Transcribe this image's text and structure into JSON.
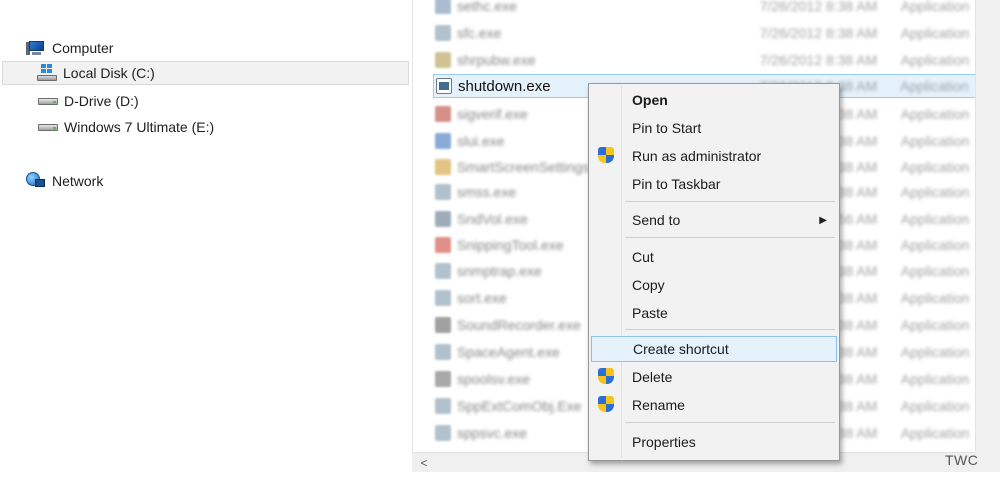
{
  "navigation": {
    "computer": "Computer",
    "drives": [
      {
        "label": "Local Disk (C:)",
        "icon": "os-drive-icon",
        "selected": true
      },
      {
        "label": "D-Drive (D:)",
        "icon": "drive-icon",
        "selected": false
      },
      {
        "label": "Windows 7 Ultimate (E:)",
        "icon": "drive-icon",
        "selected": false
      }
    ],
    "network": "Network"
  },
  "files": [
    {
      "name": "sethc.exe",
      "date": "7/26/2012 8:38 AM",
      "type": "Application",
      "icon_color": "#7d9bb8",
      "blurred": true
    },
    {
      "name": "sfc.exe",
      "date": "7/26/2012 8:38 AM",
      "type": "Application",
      "icon_color": "#8aa0b5",
      "blurred": true
    },
    {
      "name": "shrpubw.exe",
      "date": "7/26/2012 8:38 AM",
      "type": "Application",
      "icon_color": "#b8a25a",
      "blurred": true
    },
    {
      "name": "shutdown.exe",
      "date": "7/26/2012 8:38 AM",
      "type": "Application",
      "icon_color": "#3f6f8c",
      "blurred": false,
      "selected": true
    },
    {
      "name": "sigverif.exe",
      "date": "7/26/2012 8:38 AM",
      "type": "Application",
      "icon_color": "#c0554a",
      "blurred": true
    },
    {
      "name": "slui.exe",
      "date": "7/26/2012 8:38 AM",
      "type": "Application",
      "icon_color": "#4a7fc0",
      "blurred": true
    },
    {
      "name": "SmartScreenSettings.exe",
      "date": "7/26/2012 8:38 AM",
      "type": "Application",
      "icon_color": "#d6a640",
      "blurred": true
    },
    {
      "name": "smss.exe",
      "date": "7/26/2012 8:38 AM",
      "type": "Application",
      "icon_color": "#8aa0b5",
      "blurred": true
    },
    {
      "name": "SndVol.exe",
      "date": "7/26/2012 8:56 AM",
      "type": "Application",
      "icon_color": "#6b7f95",
      "blurred": true
    },
    {
      "name": "SnippingTool.exe",
      "date": "7/26/2012 8:38 AM",
      "type": "Application",
      "icon_color": "#d0554a",
      "blurred": true
    },
    {
      "name": "snmptrap.exe",
      "date": "7/26/2012 8:38 AM",
      "type": "Application",
      "icon_color": "#8aa0b5",
      "blurred": true
    },
    {
      "name": "sort.exe",
      "date": "7/26/2012 8:38 AM",
      "type": "Application",
      "icon_color": "#8aa0b5",
      "blurred": true
    },
    {
      "name": "SoundRecorder.exe",
      "date": "7/26/2012 8:38 AM",
      "type": "Application",
      "icon_color": "#6f6f6f",
      "blurred": true
    },
    {
      "name": "SpaceAgent.exe",
      "date": "7/26/2012 8:38 AM",
      "type": "Application",
      "icon_color": "#8aa0b5",
      "blurred": true
    },
    {
      "name": "spoolsv.exe",
      "date": "7/26/2012 8:38 AM",
      "type": "Application",
      "icon_color": "#7a7a7a",
      "blurred": true
    },
    {
      "name": "SppExtComObj.Exe",
      "date": "7/26/2012 8:38 AM",
      "type": "Application",
      "icon_color": "#8aa0b5",
      "blurred": true
    },
    {
      "name": "sppsvc.exe",
      "date": "7/26/2012 8:38 AM",
      "type": "Application",
      "icon_color": "#8aa0b5",
      "blurred": true
    }
  ],
  "context_menu": {
    "items": [
      {
        "label": "Open",
        "bold": true,
        "shield": false
      },
      {
        "label": "Pin to Start",
        "shield": false
      },
      {
        "label": "Run as administrator",
        "shield": true
      },
      {
        "label": "Pin to Taskbar",
        "shield": false
      },
      {
        "label": "Send to",
        "shield": false,
        "submenu_arrow": "▶"
      },
      {
        "label": "Cut",
        "shield": false
      },
      {
        "label": "Copy",
        "shield": false
      },
      {
        "label": "Paste",
        "shield": false
      },
      {
        "label": "Create shortcut",
        "shield": false,
        "hover": true
      },
      {
        "label": "Delete",
        "shield": true
      },
      {
        "label": "Rename",
        "shield": true
      },
      {
        "label": "Properties",
        "shield": false
      }
    ]
  },
  "scrollbar": {
    "left_arrow": "<"
  },
  "watermark": "TWC",
  "colors": {
    "selection_bg": "#e5f1fb",
    "selection_border": "#9ccaf2",
    "menu_bg": "#f2f2f2"
  }
}
